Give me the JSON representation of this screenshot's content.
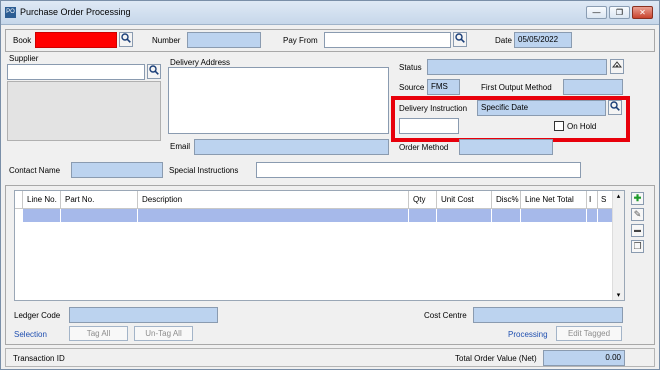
{
  "window": {
    "title": "Purchase Order Processing",
    "icon_text": "PO",
    "minimize_glyph": "—",
    "maximize_glyph": "❐",
    "close_glyph": "✕"
  },
  "header": {
    "book_label": "Book",
    "book_value": "",
    "number_label": "Number",
    "number_value": "",
    "payfrom_label": "Pay From",
    "payfrom_value": "",
    "date_label": "Date",
    "date_value": "05/05/2022"
  },
  "supplier": {
    "label": "Supplier",
    "value": ""
  },
  "delivery": {
    "address_label": "Delivery Address",
    "email_label": "Email",
    "email_value": ""
  },
  "right_panel": {
    "status_label": "Status",
    "status_value": "",
    "source_label": "Source",
    "source_value": "FMS",
    "first_output_label": "First Output Method",
    "first_output_value": "",
    "delivery_instruction_label": "Delivery Instruction",
    "delivery_instruction_value": "Specific Date",
    "delivery_date_value": "",
    "on_hold_label": "On Hold",
    "order_method_label": "Order Method",
    "order_method_value": ""
  },
  "contact": {
    "contact_name_label": "Contact Name",
    "contact_name_value": "",
    "special_instructions_label": "Special Instructions",
    "special_instructions_value": ""
  },
  "grid": {
    "columns": [
      "Line No.",
      "Part No.",
      "Description",
      "Qty",
      "Unit Cost",
      "Disc%",
      "Line Net Total",
      "I",
      "S"
    ],
    "scroll_up": "▴",
    "scroll_down": "▾"
  },
  "side_buttons": {
    "add": "✚",
    "edit": "✎",
    "remove": "▬",
    "copy": "❐"
  },
  "footer": {
    "ledger_code_label": "Ledger Code",
    "ledger_code_value": "",
    "cost_centre_label": "Cost Centre",
    "cost_centre_value": "",
    "selection_label": "Selection",
    "tag_all": "Tag All",
    "untag_all": "Un-Tag All",
    "processing_label": "Processing",
    "edit_tagged": "Edit Tagged",
    "transaction_id_label": "Transaction ID",
    "total_label": "Total Order Value (Net)",
    "total_value": "0.00"
  },
  "colors": {
    "highlight": "#e8000b",
    "field_blue": "#bcd3ef",
    "book_red": "#ff0000",
    "grid_row": "#a6b9ea",
    "link": "#1f4fb0"
  }
}
